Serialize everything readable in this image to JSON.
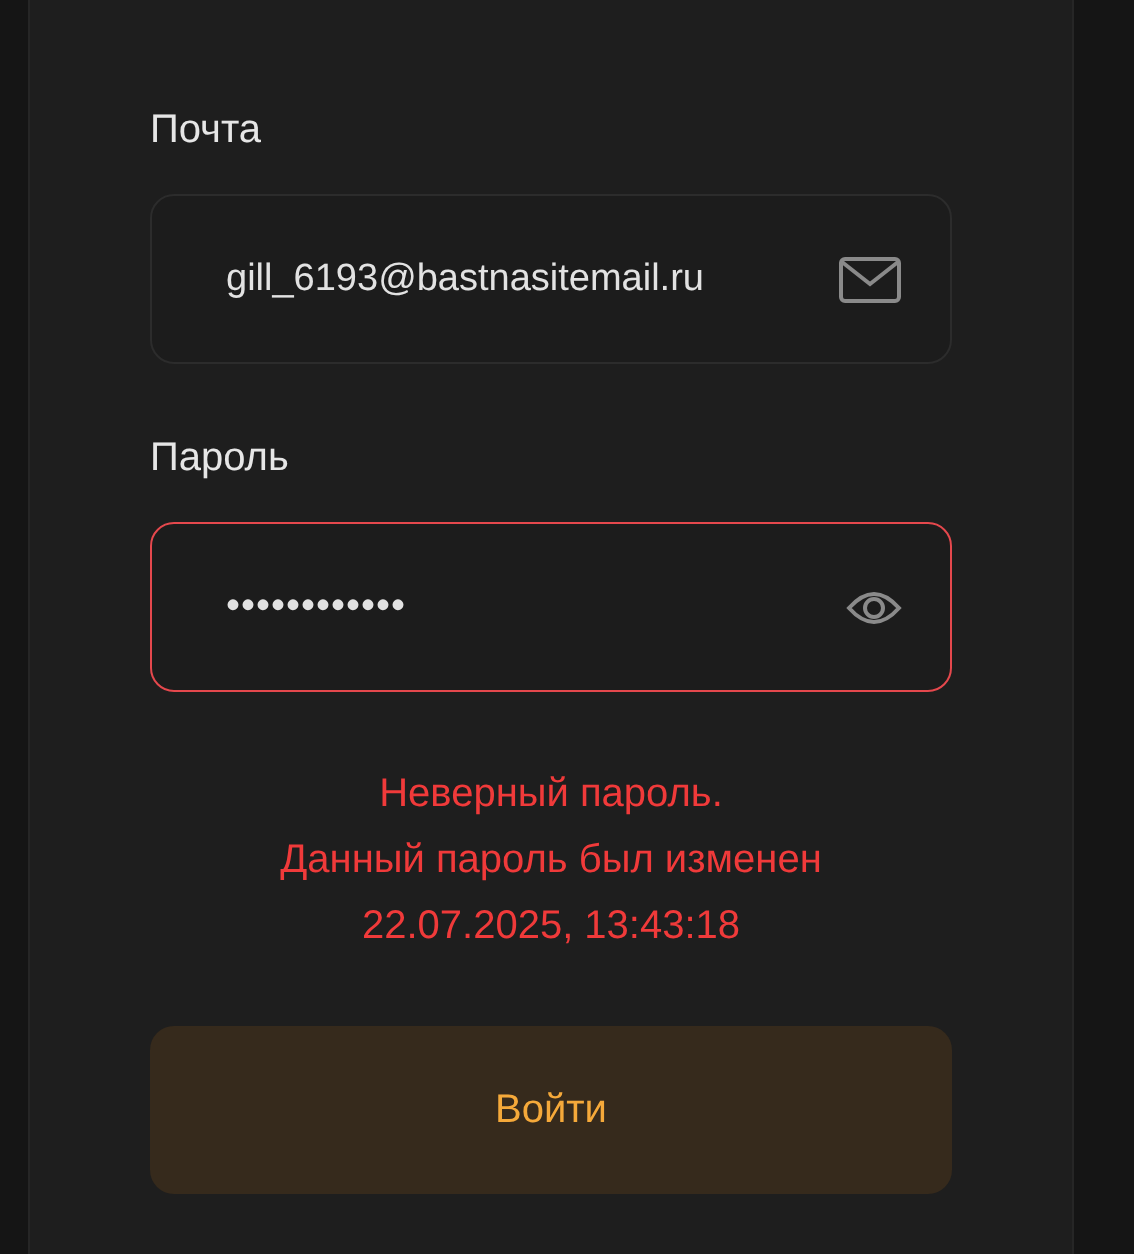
{
  "fields": [
    {
      "kind": "email",
      "label": "Почта",
      "value": "gill_6193@bastnasitemail.ru",
      "error": false
    },
    {
      "kind": "password",
      "label": "Пароль",
      "value": "••••••••••••",
      "error": true
    }
  ],
  "error_lines": [
    "Неверный пароль.",
    "Данный пароль был изменен",
    "22.07.2025, 13:43:18"
  ],
  "submit": {
    "label": "Войти"
  }
}
